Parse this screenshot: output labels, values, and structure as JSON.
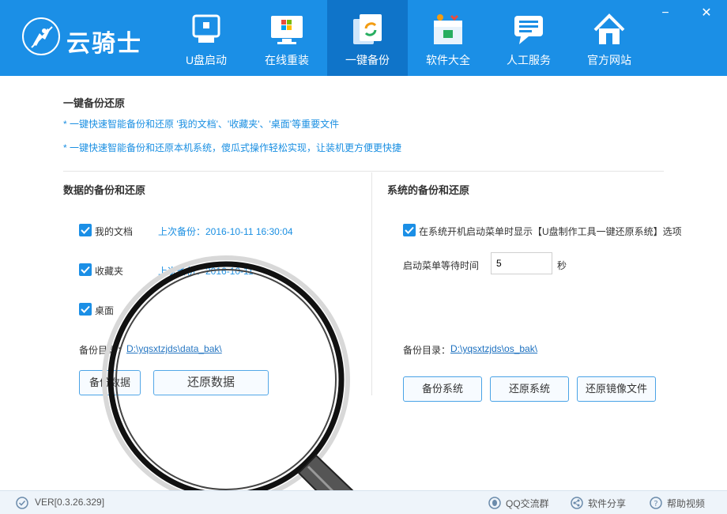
{
  "app": {
    "name": "云骑士"
  },
  "nav": [
    {
      "label": "U盘启动",
      "icon": "usb-drive-icon"
    },
    {
      "label": "在线重装",
      "icon": "windows-monitor-icon"
    },
    {
      "label": "一键备份",
      "icon": "backup-icon",
      "active": true
    },
    {
      "label": "软件大全",
      "icon": "software-box-icon"
    },
    {
      "label": "人工服务",
      "icon": "chat-bubble-icon"
    },
    {
      "label": "官方网站",
      "icon": "home-icon"
    }
  ],
  "window": {
    "minimize": "−",
    "close": "✕"
  },
  "page": {
    "title": "一键备份还原",
    "hints": [
      "* 一键快速智能备份和还原 '我的文档'、'收藏夹'、'桌面'等重要文件",
      "* 一键快速智能备份和还原本机系统，傻瓜式操作轻松实现，让装机更方便更快捷"
    ]
  },
  "data_backup": {
    "title": "数据的备份和还原",
    "items": [
      {
        "label": "我的文档",
        "checked": true,
        "last_backup": "上次备份：2016-10-11 16:30:04"
      },
      {
        "label": "收藏夹",
        "checked": true,
        "last_backup": "上次备份：2016-10-11"
      },
      {
        "label": "桌面",
        "checked": true,
        "last_backup": ""
      }
    ],
    "dir_label": "备份目录：",
    "dir_value": "D:\\yqsxtzjds\\data_bak\\",
    "backup_button": "备份数据",
    "restore_button": "还原数据"
  },
  "system_backup": {
    "title": "系统的备份和还原",
    "show_menu_label": "在系统开机启动菜单时显示【U盘制作工具一键还原系统】选项",
    "show_menu_checked": true,
    "wait_label": "启动菜单等待时间",
    "wait_value": "5",
    "wait_unit": "秒",
    "dir_label": "备份目录：",
    "dir_value": "D:\\yqsxtzjds\\os_bak\\",
    "backup_button": "备份系统",
    "restore_button": "还原系统",
    "restore_image_button": "还原镜像文件"
  },
  "footer": {
    "version": "VER[0.3.26.329]",
    "qq_group": "QQ交流群",
    "share": "软件分享",
    "help": "帮助视频"
  },
  "colors": {
    "header": "#1b8fe6",
    "active_tab": "#0f74c9",
    "accent_text": "#1a8fe2"
  }
}
